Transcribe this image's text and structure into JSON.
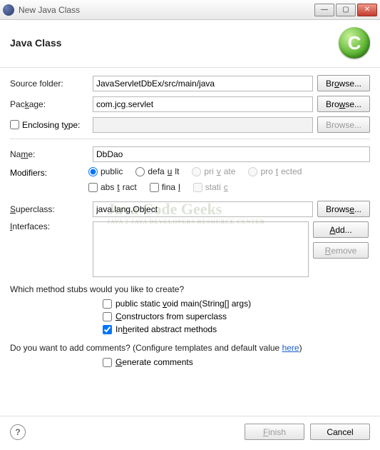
{
  "window": {
    "title": "New Java Class"
  },
  "header": {
    "title": "Java Class",
    "icon_letter": "C"
  },
  "fields": {
    "source_folder": {
      "label": "Source folder:",
      "value": "JavaServletDbEx/src/main/java",
      "browse": "Browse..."
    },
    "package": {
      "label": "Package:",
      "value": "com.jcg.servlet",
      "browse": "Browse..."
    },
    "enclosing": {
      "label": "Enclosing type:",
      "value": "",
      "browse": "Browse..."
    },
    "name": {
      "label": "Name:",
      "value": "DbDao"
    },
    "modifiers_label": "Modifiers:",
    "modifiers": {
      "public": "public",
      "default": "default",
      "private": "private",
      "protected": "protected",
      "abstract": "abstract",
      "final": "final",
      "static": "static"
    },
    "superclass": {
      "label": "Superclass:",
      "value": "java.lang.Object",
      "browse": "Browse..."
    },
    "interfaces": {
      "label": "Interfaces:",
      "add": "Add...",
      "remove": "Remove"
    }
  },
  "stubs": {
    "question": "Which method stubs would you like to create?",
    "main": "public static void main(String[] args)",
    "constructors": "Constructors from superclass",
    "inherited": "Inherited abstract methods"
  },
  "comments": {
    "question_prefix": "Do you want to add comments? (Configure templates and default value ",
    "here": "here",
    "question_suffix": ")",
    "generate": "Generate comments"
  },
  "buttons": {
    "finish": "Finish",
    "cancel": "Cancel"
  },
  "watermark": {
    "main": "Java Code Geeks",
    "sub": "JAVA 2 JAVA DEVELOPERS RESOURCE CENTER"
  }
}
